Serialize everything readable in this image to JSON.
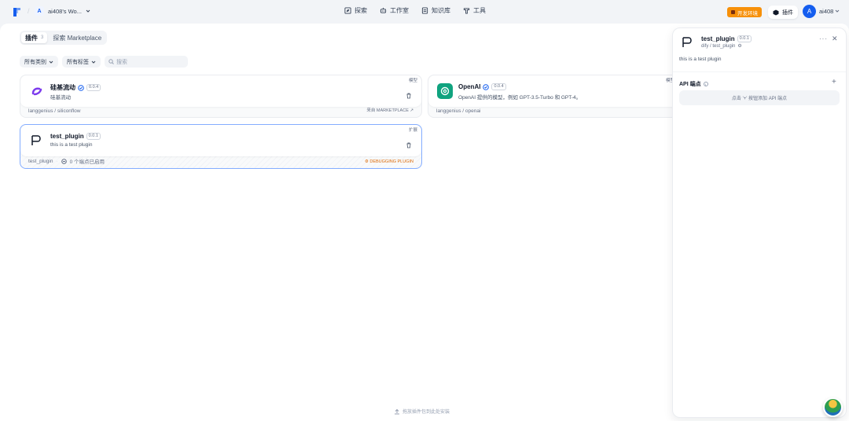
{
  "header": {
    "workspace_initial": "A",
    "workspace_name": "ai408's Wo...",
    "nav": [
      {
        "label": "探索",
        "icon": "compass-icon"
      },
      {
        "label": "工作室",
        "icon": "robot-icon"
      },
      {
        "label": "知识库",
        "icon": "book-icon"
      },
      {
        "label": "工具",
        "icon": "hammer-icon"
      }
    ],
    "env_label": "开发环境",
    "plugins_label": "插件",
    "user_initial": "A",
    "user_name": "ai408"
  },
  "tabs": [
    {
      "label": "插件",
      "count": "3",
      "active": true
    },
    {
      "label": "探索 Marketplace",
      "active": false
    }
  ],
  "filters": {
    "category": "所有类别",
    "tags": "所有标签",
    "search_placeholder": "搜索"
  },
  "plugins": [
    {
      "name": "硅基流动",
      "version": "0.0.4",
      "desc": "硅基流动",
      "tag": "模型",
      "org": "langgenius / siliconflow",
      "source": "来自 MARKETPLACE ↗"
    },
    {
      "name": "OpenAI",
      "version": "0.0.4",
      "desc": "OpenAI 提供的模型，例如 GPT-3.5-Turbo 和 GPT-4。",
      "tag": "模型",
      "org": "langgenius / openai",
      "source": ""
    },
    {
      "name": "test_plugin",
      "version": "0.0.1",
      "desc": "this is a test plugin",
      "tag": "扩展",
      "org": "test_plugin",
      "endpoints": "0 个端点已启用",
      "source": "DEBUGGING PLUGIN"
    }
  ],
  "drawer": {
    "name": "test_plugin",
    "version": "0.0.1",
    "path": "dify / test_plugin",
    "desc": "this is a test plugin",
    "api_title": "API 端点",
    "empty_hint": "点击 '+' 按钮添加 API 端点"
  },
  "drop_hint": "拖放插件包到此处安装",
  "colors": {
    "accent": "#155eef",
    "env": "#f79009",
    "debug": "#dc6803"
  }
}
